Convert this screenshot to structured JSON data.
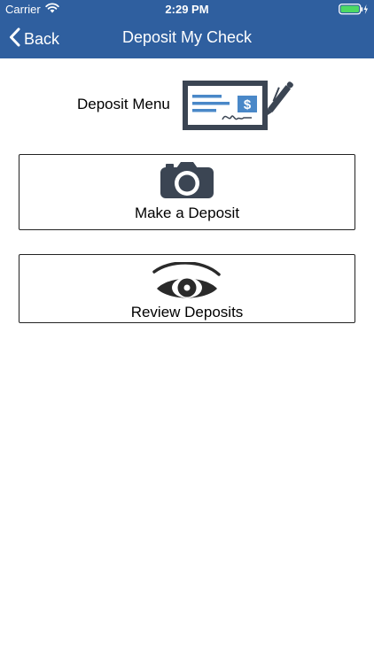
{
  "status_bar": {
    "carrier": "Carrier",
    "time": "2:29 PM",
    "wifi_icon": "wifi-icon",
    "battery_icon": "battery-charging-icon",
    "battery_color": "#4cd964"
  },
  "nav": {
    "back_label": "Back",
    "title": "Deposit My Check",
    "back_icon": "chevron-left-icon"
  },
  "menu": {
    "label": "Deposit Menu",
    "illustration_icon": "check-with-pen-icon"
  },
  "actions": [
    {
      "label": "Make a Deposit",
      "icon": "camera-icon"
    },
    {
      "label": "Review Deposits",
      "icon": "eye-icon"
    }
  ],
  "colors": {
    "header_bg": "#2f5f9f",
    "icon_dark": "#3b4553",
    "check_blue": "#4a88c8"
  }
}
